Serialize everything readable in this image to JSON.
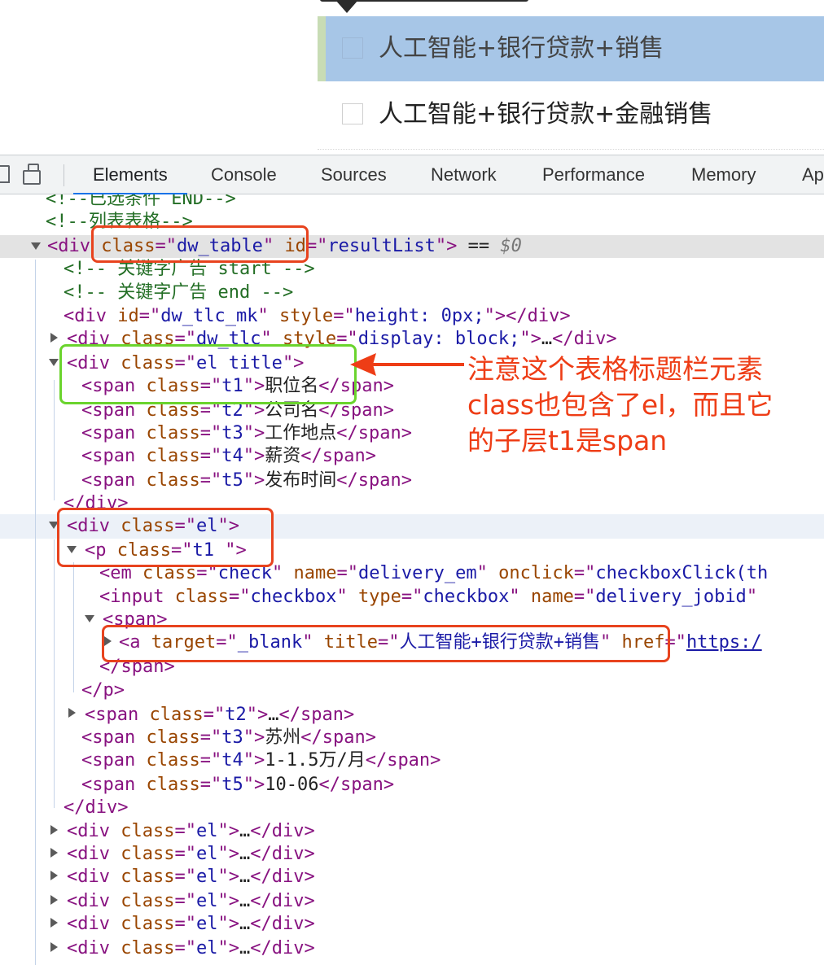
{
  "page": {
    "job_rows": [
      {
        "title": "人工智能+银行贷款+销售",
        "highlighted": true
      },
      {
        "title": "人工智能+银行贷款+金融销售",
        "highlighted": false
      }
    ]
  },
  "devtools": {
    "tabs": [
      "Elements",
      "Console",
      "Sources",
      "Network",
      "Performance",
      "Memory",
      "Ap"
    ],
    "active_tab": "Elements",
    "icons": [
      "inspect-element-icon",
      "device-toolbar-icon"
    ]
  },
  "dom": {
    "comment_selected_end": "<!--已选条件 END-->",
    "comment_list_table": "<!--列表表格-->",
    "table_class": "dw_table",
    "table_id": "resultList",
    "selected_marker": "$0",
    "comment_keyword_ad_start": "<!-- 关键字广告 start -->",
    "comment_keyword_ad_end": "<!-- 关键字广告 end -->",
    "tlc_mk_id": "dw_tlc_mk",
    "tlc_mk_style": "height: 0px;",
    "tlc_class": "dw_tlc",
    "tlc_style": "display: block;",
    "title_div_class": "el title",
    "title_spans": [
      {
        "cls": "t1",
        "text": "职位名"
      },
      {
        "cls": "t2",
        "text": "公司名"
      },
      {
        "cls": "t3",
        "text": "工作地点"
      },
      {
        "cls": "t4",
        "text": "薪资"
      },
      {
        "cls": "t5",
        "text": "发布时间"
      }
    ],
    "row_div_class": "el",
    "p_class": "t1 ",
    "em_class": "check",
    "em_name": "delivery_em",
    "em_onclick": "checkboxClick(th",
    "input_class": "checkbox",
    "input_type": "checkbox",
    "input_name": "delivery_jobid",
    "a_target": "_blank",
    "a_title": "人工智能+银行贷款+销售",
    "a_href": "https:/",
    "span_t2_class": "t2",
    "span_t3_class": "t3",
    "span_t3_text": "苏州",
    "span_t4_class": "t4",
    "span_t4_text": "1-1.5万/月",
    "span_t5_class": "t5",
    "span_t5_text": "10-06",
    "collapsed_el_class": "el",
    "collapsed_el_count": 6
  },
  "annotation": {
    "note_lines": [
      "注意这个表格标题栏元素",
      "class也包含了el，而且它",
      "的子层t1是span"
    ],
    "colors": {
      "red": "#e8431e",
      "green": "#6ad42d",
      "note_text": "#ee3d16"
    }
  }
}
